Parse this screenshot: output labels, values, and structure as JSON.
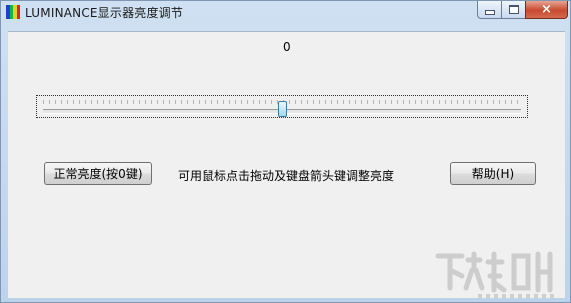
{
  "window": {
    "title": "LUMINANCE显示器亮度调节",
    "close_symbol": "×"
  },
  "brightness": {
    "value_text": "0",
    "slider_value": 0,
    "slider_min": -100,
    "slider_max": 100
  },
  "buttons": {
    "normal_label": "正常亮度(按0键)",
    "help_label": "帮助(H)"
  },
  "hint_text": "可用鼠标点击拖动及键盘箭头键调整亮度",
  "colors": {
    "client_bg": "#f0f0f0",
    "thumb": "#9fd8f2",
    "close_button": "#c74a2f"
  },
  "icons": [
    "app-icon",
    "minimize-icon",
    "maximize-icon",
    "close-icon",
    "watermark-logo"
  ]
}
